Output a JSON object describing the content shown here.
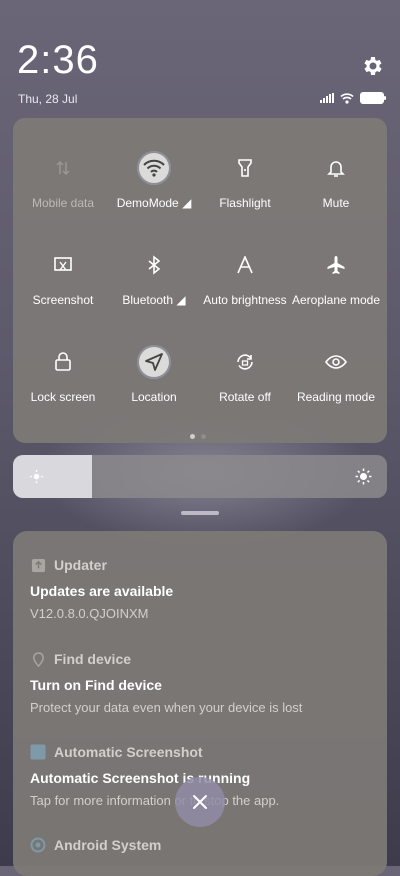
{
  "status_bar": {
    "time": "2:36",
    "date": "Thu, 28 Jul",
    "battery_label": "100"
  },
  "quick_settings": {
    "tiles": [
      {
        "label": "Mobile data",
        "icon": "mobile-data-icon",
        "active": false,
        "dimmed": true
      },
      {
        "label": "DemoMode ◢",
        "icon": "wifi-icon",
        "active": true,
        "dimmed": false
      },
      {
        "label": "Flashlight",
        "icon": "flashlight-icon",
        "active": false,
        "dimmed": false
      },
      {
        "label": "Mute",
        "icon": "bell-icon",
        "active": false,
        "dimmed": false
      },
      {
        "label": "Screenshot",
        "icon": "screenshot-icon",
        "active": false,
        "dimmed": false
      },
      {
        "label": "Bluetooth ◢",
        "icon": "bluetooth-icon",
        "active": false,
        "dimmed": false
      },
      {
        "label": "Auto brightness",
        "icon": "auto-brightness-icon",
        "active": false,
        "dimmed": false
      },
      {
        "label": "Aeroplane mode",
        "icon": "airplane-icon",
        "active": false,
        "dimmed": false
      },
      {
        "label": "Lock screen",
        "icon": "lock-icon",
        "active": false,
        "dimmed": false
      },
      {
        "label": "Location",
        "icon": "location-icon",
        "active": true,
        "dimmed": false
      },
      {
        "label": "Rotate off",
        "icon": "rotate-lock-icon",
        "active": false,
        "dimmed": false
      },
      {
        "label": "Reading mode",
        "icon": "eye-icon",
        "active": false,
        "dimmed": false
      }
    ],
    "page_count": 2,
    "current_page": 1
  },
  "brightness": {
    "level": 0.21
  },
  "notifications": [
    {
      "app": "Updater",
      "title": "Updates are available",
      "body": "V12.0.8.0.QJOINXM",
      "icon": "updater-icon"
    },
    {
      "app": "Find device",
      "title": "Turn on Find device",
      "body": "Protect your data even when your device is lost",
      "icon": "find-device-icon"
    },
    {
      "app": "Automatic Screenshot",
      "title": "Automatic Screenshot is running",
      "body": "Tap for more information or to stop the app.",
      "icon": "auto-screenshot-icon"
    },
    {
      "app": "Android System",
      "title": "",
      "body": "",
      "icon": "android-system-icon"
    }
  ],
  "colors": {
    "panel": "#7d7a76",
    "active_tile": "#e6e6e6",
    "text_primary": "#ffffff",
    "text_secondary": "#d3d0cb"
  }
}
